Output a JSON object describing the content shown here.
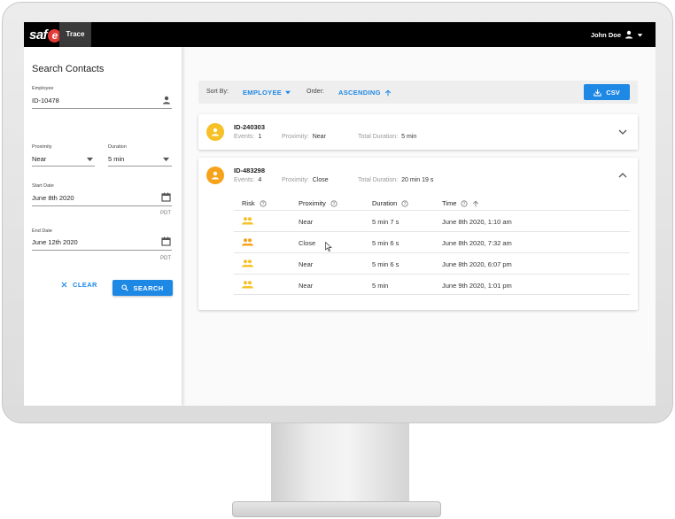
{
  "app": {
    "logo_text": "saf",
    "logo_badge": "e",
    "nav_tab": "Trace",
    "user_name": "John Doe"
  },
  "sidebar": {
    "title": "Search Contacts",
    "employee": {
      "label": "Employee",
      "value": "ID-10478"
    },
    "proximity": {
      "label": "Proximity",
      "value": "Near"
    },
    "duration": {
      "label": "Duration",
      "value": "5 min"
    },
    "start_date": {
      "label": "Start Date",
      "value": "June 8th 2020",
      "tz": "PDT"
    },
    "end_date": {
      "label": "End Date",
      "value": "June 12th 2020",
      "tz": "PDT"
    },
    "clear_label": "CLEAR",
    "search_label": "SEARCH"
  },
  "toolbar": {
    "sort_by_label": "Sort By:",
    "sort_by_value": "EMPLOYEE",
    "order_label": "Order:",
    "order_value": "ASCENDING",
    "csv_label": "CSV"
  },
  "cards": [
    {
      "id": "ID-240303",
      "avatar_color": "#f6c026",
      "events_label": "Events:",
      "events": "1",
      "proximity_label": "Proximity:",
      "proximity": "Near",
      "duration_label": "Total Duration:",
      "duration": "5 min",
      "expanded": false
    },
    {
      "id": "ID-483298",
      "avatar_color": "#f7a21b",
      "events_label": "Events:",
      "events": "4",
      "proximity_label": "Proximity:",
      "proximity": "Close",
      "duration_label": "Total Duration:",
      "duration": "20 min 19 s",
      "expanded": true
    }
  ],
  "table": {
    "headers": {
      "risk": "Risk",
      "proximity": "Proximity",
      "duration": "Duration",
      "time": "Time"
    },
    "rows": [
      {
        "risk_color": "#f6c026",
        "proximity": "Near",
        "duration": "5 min 7 s",
        "time": "June 8th 2020, 1:10 am"
      },
      {
        "risk_color": "#f7a21b",
        "proximity": "Close",
        "duration": "5 min 6 s",
        "time": "June 8th 2020, 7:32 am"
      },
      {
        "risk_color": "#f6c026",
        "proximity": "Near",
        "duration": "5 min 6 s",
        "time": "June 8th 2020, 6:07 pm"
      },
      {
        "risk_color": "#f6c026",
        "proximity": "Near",
        "duration": "5 min",
        "time": "June 9th 2020, 1:01 pm"
      }
    ]
  },
  "colors": {
    "accent": "#1e88e5",
    "topbar": "#000000"
  }
}
